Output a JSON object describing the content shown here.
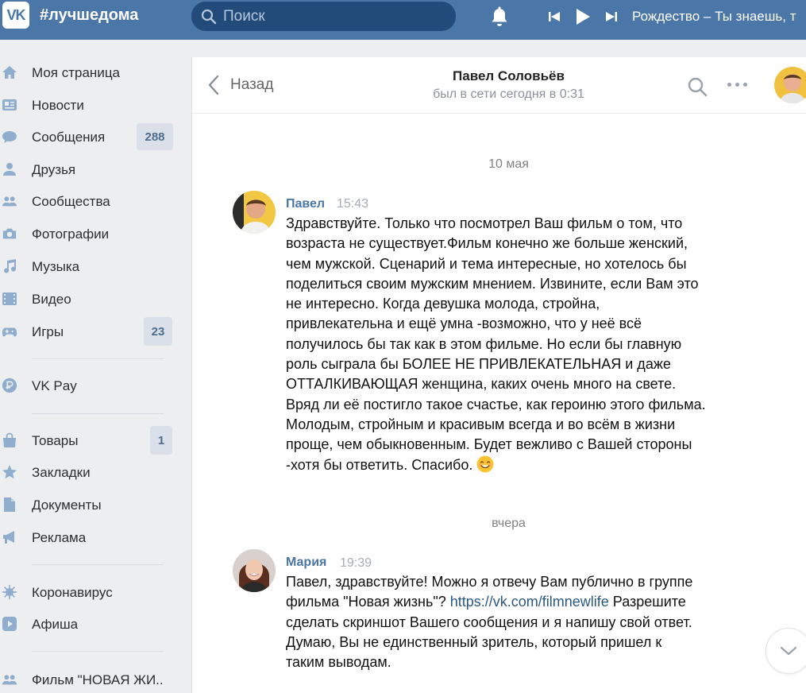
{
  "header": {
    "logo_text": "VK",
    "brand": "#лучшедома",
    "search_placeholder": "Поиск",
    "track_title": "Рождество – Ты знаешь, т"
  },
  "sidebar": {
    "items": [
      {
        "label": "Моя страница",
        "icon": "home-icon"
      },
      {
        "label": "Новости",
        "icon": "news-icon"
      },
      {
        "label": "Сообщения",
        "icon": "messages-icon",
        "badge": "288"
      },
      {
        "label": "Друзья",
        "icon": "friends-icon"
      },
      {
        "label": "Сообщества",
        "icon": "communities-icon"
      },
      {
        "label": "Фотографии",
        "icon": "camera-icon"
      },
      {
        "label": "Музыка",
        "icon": "music-icon"
      },
      {
        "label": "Видео",
        "icon": "video-icon"
      },
      {
        "label": "Игры",
        "icon": "games-icon",
        "badge": "23"
      },
      {
        "label": "VK Pay",
        "icon": "vkpay-icon"
      },
      {
        "label": "Товары",
        "icon": "shop-icon",
        "badge": "1"
      },
      {
        "label": "Закладки",
        "icon": "star-icon"
      },
      {
        "label": "Документы",
        "icon": "document-icon"
      },
      {
        "label": "Реклама",
        "icon": "megaphone-icon"
      },
      {
        "label": "Коронавирус",
        "icon": "virus-icon"
      },
      {
        "label": "Афиша",
        "icon": "play-icon"
      },
      {
        "label": "Фильм \"НОВАЯ ЖИ..",
        "icon": "group-icon"
      }
    ]
  },
  "chat": {
    "back_label": "Назад",
    "peer_name": "Павел Соловьёв",
    "peer_status": "был в сети сегодня в 0:31",
    "messages": [
      {
        "date": "10 мая",
        "author": "Павел",
        "time": "15:43",
        "lines": [
          "Здравствуйте. Только что посмотрел Ваш фильм о том, что",
          "возраста не существует.Фильм конечно же больше женский,",
          "чем мужской. Сценарий и тема интересные, но хотелось бы",
          "поделиться своим мужским мнением. Извините, если Вам это",
          "не интересно. Когда девушка молода, стройна,",
          "привлекательна и ещё умна -возможно, что у неё всё",
          "получилось бы так как в этом фильме. Но если бы главную",
          "роль сыграла бы БОЛЕЕ НЕ ПРИВЛЕКАТЕЛЬНАЯ и даже",
          "ОТТАЛКИВАЮЩАЯ женщина, каких очень много на свете.",
          "Вряд ли её постигло такое счастье, как героиню этого фильма.",
          "Молодым, стройным и красивым всегда и во всём в жизни",
          "проще, чем обыкновенным. Будет вежливо с Вашей стороны",
          "-хотя бы ответить. Спасибо."
        ],
        "emoji": "smile-emoji"
      },
      {
        "date": "вчера",
        "author": "Мария",
        "time": "19:39",
        "line1": "Павел, здравствуйте! Можно я отвечу Вам публично в группе",
        "line2_before": "фильма \"Новая жизнь\"? ",
        "link": "https://vk.com/filmnewlife",
        "line2_after": " Разрешите",
        "lines_rest": [
          "сделать скриншот Вашего сообщения и я напишу свой ответ.",
          "Думаю, Вы не единственный зритель, который пришел к",
          "таким выводам."
        ]
      }
    ]
  },
  "colors": {
    "header_bg": "#4a76a8",
    "accent": "#4a76a8",
    "page_bg": "#edeef0",
    "badge_bg": "#d9e0e9"
  }
}
